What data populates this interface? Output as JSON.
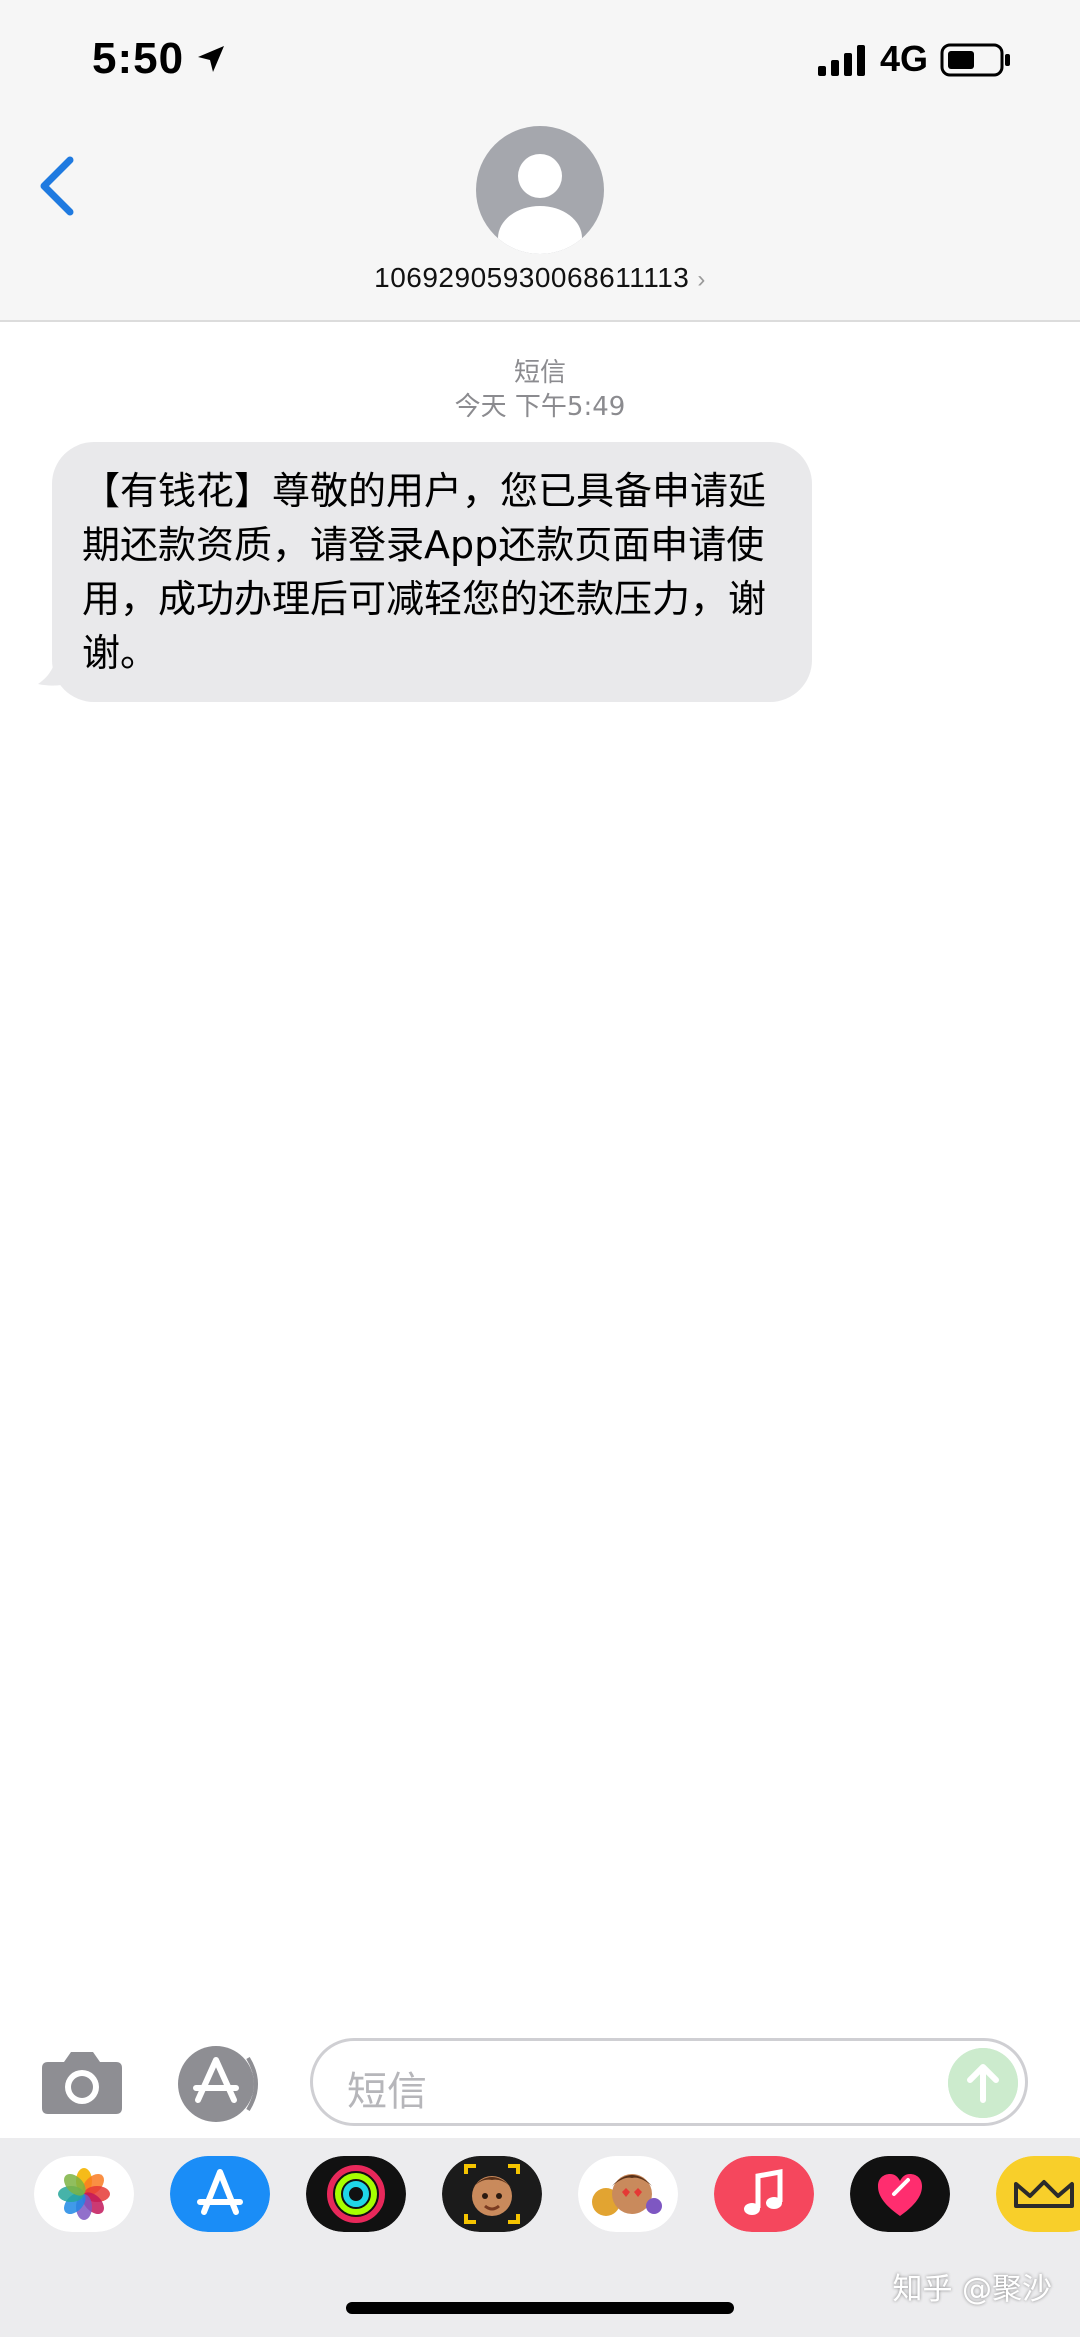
{
  "status_bar": {
    "time": "5:50",
    "network": "4G"
  },
  "header": {
    "contact": "10692905930068611113",
    "chevron": "›"
  },
  "conversation": {
    "message_type": "短信",
    "timestamp": "今天 下午5:49",
    "messages": [
      {
        "direction": "incoming",
        "text": "【有钱花】尊敬的用户，您已具备申请延期还款资质，请登录App还款页面申请使用，成功办理后可减轻您的还款压力，谢谢。"
      }
    ]
  },
  "composer": {
    "placeholder": "短信"
  },
  "app_drawer": {
    "apps": [
      {
        "icon": "photos-icon"
      },
      {
        "icon": "app-store-icon"
      },
      {
        "icon": "activity-icon"
      },
      {
        "icon": "memoji-icon"
      },
      {
        "icon": "animoji-stickers-icon"
      },
      {
        "icon": "music-icon"
      },
      {
        "icon": "digital-touch-icon"
      },
      {
        "icon": "yellow-app-icon"
      }
    ]
  },
  "watermark": "知乎 @聚沙",
  "colors": {
    "accent_blue": "#1f7ae0",
    "bubble_gray": "#e9e9eb",
    "header_gray": "#f6f6f6",
    "send_green": "#ccebcd"
  }
}
